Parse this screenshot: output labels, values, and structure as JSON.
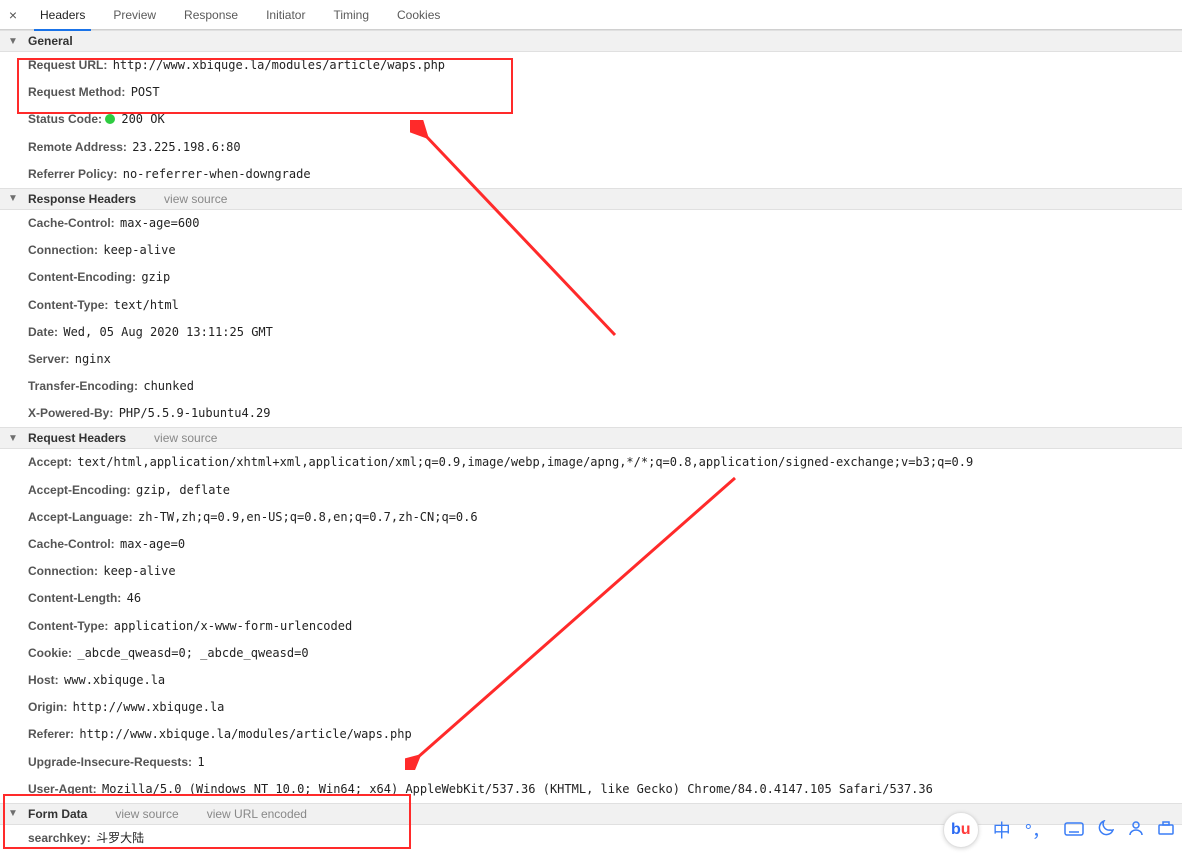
{
  "tabs": {
    "headers": "Headers",
    "preview": "Preview",
    "response": "Response",
    "initiator": "Initiator",
    "timing": "Timing",
    "cookies": "Cookies"
  },
  "sections": {
    "general": "General",
    "response_headers": "Response Headers",
    "request_headers": "Request Headers",
    "form_data": "Form Data",
    "view_source": "view source",
    "view_url_encoded": "view URL encoded"
  },
  "general": {
    "request_url_k": "Request URL:",
    "request_url_v": "http://www.xbiquge.la/modules/article/waps.php",
    "request_method_k": "Request Method:",
    "request_method_v": "POST",
    "status_code_k": "Status Code:",
    "status_code_v": "200 OK",
    "remote_address_k": "Remote Address:",
    "remote_address_v": "23.225.198.6:80",
    "referrer_policy_k": "Referrer Policy:",
    "referrer_policy_v": "no-referrer-when-downgrade"
  },
  "response_headers": {
    "cache_control_k": "Cache-Control:",
    "cache_control_v": "max-age=600",
    "connection_k": "Connection:",
    "connection_v": "keep-alive",
    "content_encoding_k": "Content-Encoding:",
    "content_encoding_v": "gzip",
    "content_type_k": "Content-Type:",
    "content_type_v": "text/html",
    "date_k": "Date:",
    "date_v": "Wed, 05 Aug 2020 13:11:25 GMT",
    "server_k": "Server:",
    "server_v": "nginx",
    "transfer_encoding_k": "Transfer-Encoding:",
    "transfer_encoding_v": "chunked",
    "x_powered_by_k": "X-Powered-By:",
    "x_powered_by_v": "PHP/5.5.9-1ubuntu4.29"
  },
  "request_headers": {
    "accept_k": "Accept:",
    "accept_v": "text/html,application/xhtml+xml,application/xml;q=0.9,image/webp,image/apng,*/*;q=0.8,application/signed-exchange;v=b3;q=0.9",
    "accept_encoding_k": "Accept-Encoding:",
    "accept_encoding_v": "gzip, deflate",
    "accept_language_k": "Accept-Language:",
    "accept_language_v": "zh-TW,zh;q=0.9,en-US;q=0.8,en;q=0.7,zh-CN;q=0.6",
    "cache_control_k": "Cache-Control:",
    "cache_control_v": "max-age=0",
    "connection_k": "Connection:",
    "connection_v": "keep-alive",
    "content_length_k": "Content-Length:",
    "content_length_v": "46",
    "content_type_k": "Content-Type:",
    "content_type_v": "application/x-www-form-urlencoded",
    "cookie_k": "Cookie:",
    "cookie_v": "_abcde_qweasd=0; _abcde_qweasd=0",
    "host_k": "Host:",
    "host_v": "www.xbiquge.la",
    "origin_k": "Origin:",
    "origin_v": "http://www.xbiquge.la",
    "referer_k": "Referer:",
    "referer_v": "http://www.xbiquge.la/modules/article/waps.php",
    "upgrade_insecure_k": "Upgrade-Insecure-Requests:",
    "upgrade_insecure_v": "1",
    "user_agent_k": "User-Agent:",
    "user_agent_v": "Mozilla/5.0 (Windows NT 10.0; Win64; x64) AppleWebKit/537.36 (KHTML, like Gecko) Chrome/84.0.4147.105 Safari/537.36"
  },
  "form_data": {
    "searchkey_k": "searchkey:",
    "searchkey_v": "斗罗大陆"
  },
  "tray": {
    "zhong": "中"
  }
}
